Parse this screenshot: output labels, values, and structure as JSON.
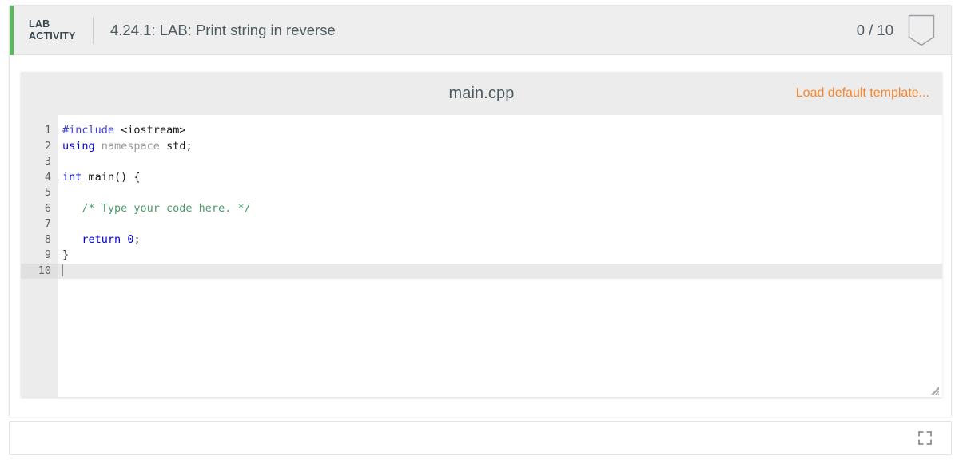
{
  "header": {
    "lab_tag_line1": "LAB",
    "lab_tag_line2": "ACTIVITY",
    "title": "4.24.1: LAB: Print string in reverse",
    "score": "0 / 10",
    "score_icon": "shield-outline-icon",
    "accent_color": "#5cb860"
  },
  "editor": {
    "filename": "main.cpp",
    "load_template_label": "Load default template...",
    "load_template_color": "#f5862e",
    "active_line": 10,
    "line_numbers": [
      "1",
      "2",
      "3",
      "4",
      "5",
      "6",
      "7",
      "8",
      "9",
      "10"
    ],
    "lines": [
      {
        "number": "1",
        "tokens": [
          {
            "text": "#include",
            "type": "preprocessor"
          },
          {
            "text": " ",
            "type": "plain"
          },
          {
            "text": "<iostream>",
            "type": "plain"
          }
        ]
      },
      {
        "number": "2",
        "tokens": [
          {
            "text": "using",
            "type": "keyword"
          },
          {
            "text": " ",
            "type": "plain"
          },
          {
            "text": "namespace",
            "type": "namespace"
          },
          {
            "text": " ",
            "type": "plain"
          },
          {
            "text": "std;",
            "type": "plain"
          }
        ]
      },
      {
        "number": "3",
        "tokens": []
      },
      {
        "number": "4",
        "tokens": [
          {
            "text": "int",
            "type": "keyword"
          },
          {
            "text": " ",
            "type": "plain"
          },
          {
            "text": "main() {",
            "type": "plain"
          }
        ]
      },
      {
        "number": "5",
        "tokens": []
      },
      {
        "number": "6",
        "tokens": [
          {
            "text": "   /* Type your code here. */",
            "type": "comment"
          }
        ]
      },
      {
        "number": "7",
        "tokens": []
      },
      {
        "number": "8",
        "tokens": [
          {
            "text": "   ",
            "type": "plain"
          },
          {
            "text": "return",
            "type": "keyword"
          },
          {
            "text": " ",
            "type": "plain"
          },
          {
            "text": "0",
            "type": "number"
          },
          {
            "text": ";",
            "type": "plain"
          }
        ]
      },
      {
        "number": "9",
        "tokens": [
          {
            "text": "}",
            "type": "plain"
          }
        ]
      },
      {
        "number": "10",
        "tokens": []
      }
    ],
    "resize_grip_icon": "resize-handle-icon"
  },
  "footer": {
    "expand_icon": "fullscreen-expand-icon"
  }
}
